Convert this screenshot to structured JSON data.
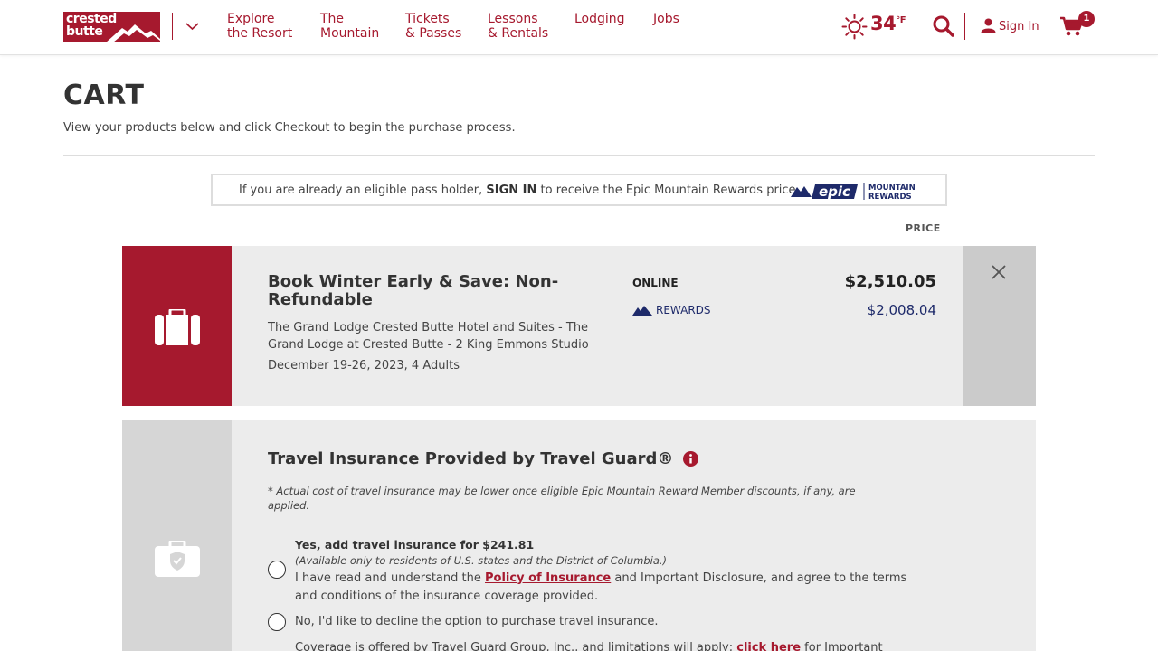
{
  "header": {
    "logo_text_line1": "crested",
    "logo_text_line2": "butte",
    "nav": [
      {
        "line1": "Explore",
        "line2": "the Resort"
      },
      {
        "line1": "The",
        "line2": "Mountain"
      },
      {
        "line1": "Tickets",
        "line2": "& Passes"
      },
      {
        "line1": "Lessons",
        "line2": "& Rentals"
      },
      {
        "line1": "Lodging",
        "line2": ""
      },
      {
        "line1": "Jobs",
        "line2": ""
      }
    ],
    "weather_icon": "sun-icon",
    "temperature": "34",
    "temperature_unit": "°F",
    "sign_in": "Sign In",
    "cart_count": "1",
    "brand_color": "#a6192e"
  },
  "page": {
    "title": "CART",
    "subtitle": "View your products below and click Checkout to begin the purchase process."
  },
  "notice": {
    "prefix": "If you are already an eligible pass holder,",
    "sign_in": "SIGN IN",
    "suffix": "to receive the Epic Mountain Rewards price.",
    "logo_word": "epic",
    "logo_line1": "MOUNTAIN",
    "logo_line2": "REWARDS"
  },
  "price_header": "PRICE",
  "cart_item": {
    "title": "Book Winter Early & Save: Non-Refundable",
    "description": "The Grand Lodge Crested Butte Hotel and Suites - The Grand Lodge at Crested Butte - 2 King Emmons Studio",
    "dates": "December 19-26, 2023, 4 Adults",
    "online_label": "ONLINE",
    "online_price": "$2,510.05",
    "rewards_label": "REWARDS",
    "rewards_price": "$2,008.04"
  },
  "insurance": {
    "title": "Travel Insurance Provided by Travel Guard®",
    "note": "* Actual cost of travel insurance may be lower once eligible Epic Mountain Reward Member discounts, if any, are applied.",
    "option_yes_title": "Yes, add travel insurance for $241.81",
    "option_yes_availability": "(Available only to residents of U.S. states and the District of Columbia.)",
    "option_yes_body_before": "I have read and understand the",
    "option_yes_link": "Policy of Insurance",
    "option_yes_body_after": "and Important Disclosure, and agree to the terms and conditions of the insurance coverage provided.",
    "option_no": "No, I'd like to decline the option to purchase travel insurance.",
    "coverage_before": "Coverage is offered by Travel Guard Group, Inc., and limitations will apply;",
    "coverage_link": "click here",
    "coverage_after": "for Important"
  }
}
